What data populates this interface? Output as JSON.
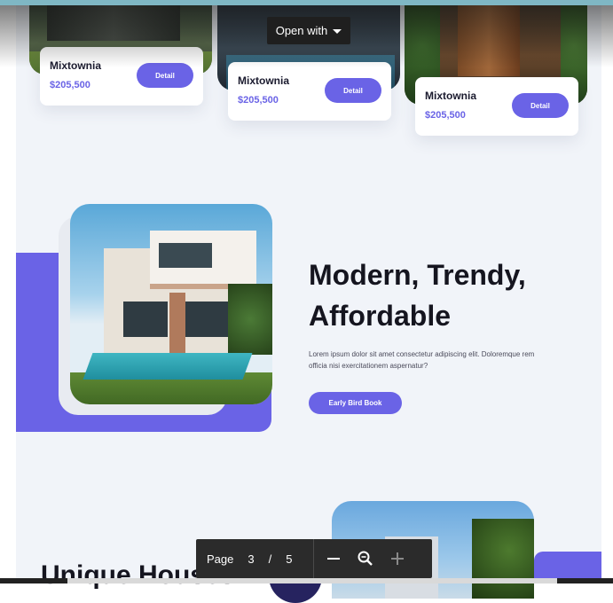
{
  "viewer": {
    "open_with_label": "Open with",
    "toolbar": {
      "page_label": "Page",
      "current_page": "3",
      "separator": "/",
      "total_pages": "5"
    }
  },
  "listings": [
    {
      "name": "Mixtownia",
      "price": "$205,500",
      "button": "Detail"
    },
    {
      "name": "Mixtownia",
      "price": "$205,500",
      "button": "Detail"
    },
    {
      "name": "Mixtownia",
      "price": "$205,500",
      "button": "Detail"
    }
  ],
  "hero": {
    "title": "Modern, Trendy, Affordable",
    "description": "Lorem ipsum dolor sit amet consectetur adipiscing elit. Doloremque rem officia nisi exercitationem aspernatur?",
    "button": "Early Bird Book"
  },
  "lower": {
    "heading": "Unique Houses"
  },
  "colors": {
    "accent": "#6a63e6",
    "page_bg": "#f1f4f9",
    "heading": "#15151f"
  }
}
